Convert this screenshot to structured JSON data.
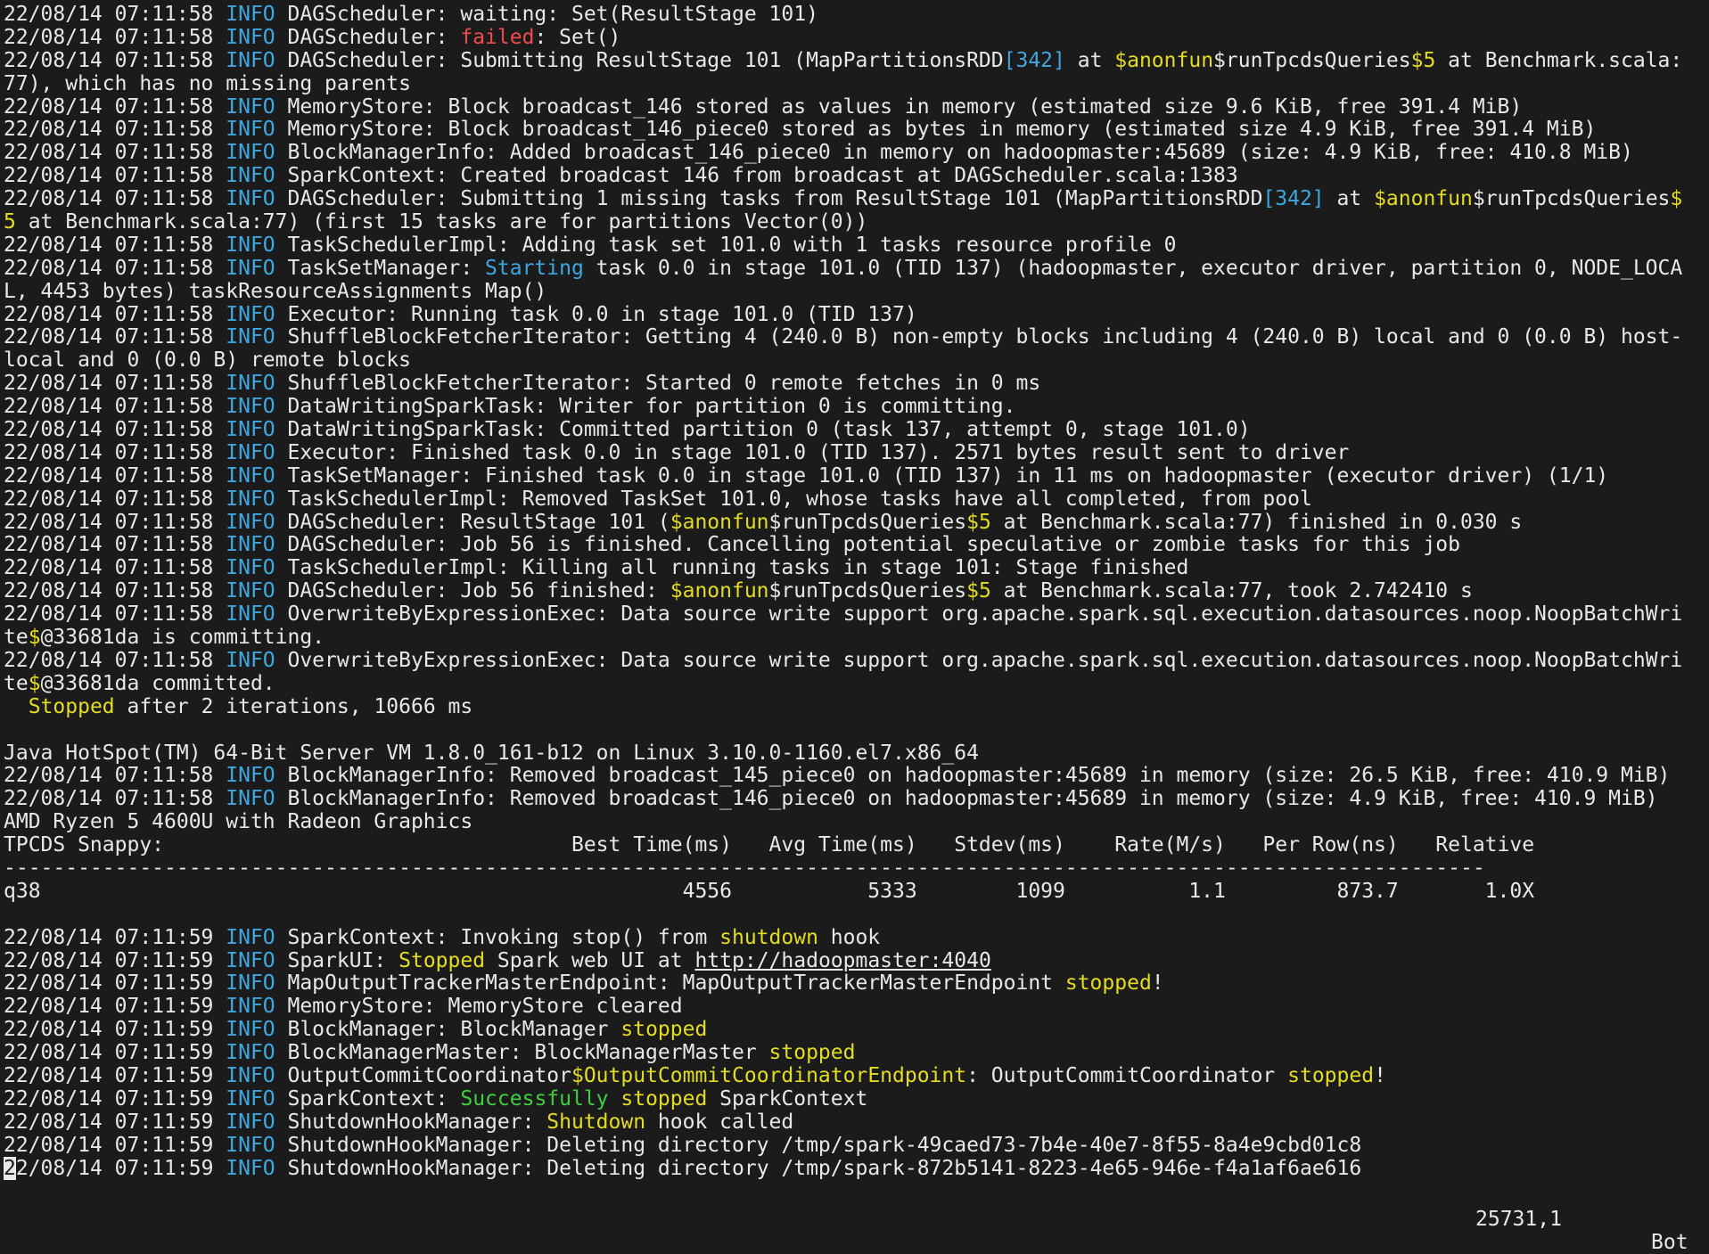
{
  "theme": {
    "background": "#1b1b1b",
    "foreground": "#e8e8e8",
    "info": "#3fa7e0",
    "failed": "#ef4c4c",
    "keyword": "#e4dc20",
    "success": "#3ed03e"
  },
  "terminal": {
    "lines": [
      [
        {
          "t": "22/08/14 07:11:58 "
        },
        {
          "t": "INFO",
          "c": "blue"
        },
        {
          "t": " DAGScheduler: waiting: Set(ResultStage 101)"
        }
      ],
      [
        {
          "t": "22/08/14 07:11:58 "
        },
        {
          "t": "INFO",
          "c": "blue"
        },
        {
          "t": " DAGScheduler: "
        },
        {
          "t": "failed",
          "c": "red"
        },
        {
          "t": ": Set()"
        }
      ],
      [
        {
          "t": "22/08/14 07:11:58 "
        },
        {
          "t": "INFO",
          "c": "blue"
        },
        {
          "t": " DAGScheduler: Submitting ResultStage 101 (MapPartitionsRDD"
        },
        {
          "t": "[342]",
          "c": "blue"
        },
        {
          "t": " at "
        },
        {
          "t": "$anonfun",
          "c": "yellow"
        },
        {
          "t": "$runTpcdsQueries"
        },
        {
          "t": "$5",
          "c": "yellow"
        },
        {
          "t": " at Benchmark.scala:"
        }
      ],
      [
        {
          "t": "77), which has no missing parents"
        }
      ],
      [
        {
          "t": "22/08/14 07:11:58 "
        },
        {
          "t": "INFO",
          "c": "blue"
        },
        {
          "t": " MemoryStore: Block broadcast_146 stored as values in memory (estimated size 9.6 KiB, free 391.4 MiB)"
        }
      ],
      [
        {
          "t": "22/08/14 07:11:58 "
        },
        {
          "t": "INFO",
          "c": "blue"
        },
        {
          "t": " MemoryStore: Block broadcast_146_piece0 stored as bytes in memory (estimated size 4.9 KiB, free 391.4 MiB)"
        }
      ],
      [
        {
          "t": "22/08/14 07:11:58 "
        },
        {
          "t": "INFO",
          "c": "blue"
        },
        {
          "t": " BlockManagerInfo: Added broadcast_146_piece0 in memory on hadoopmaster:45689 (size: 4.9 KiB, free: 410.8 MiB)"
        }
      ],
      [
        {
          "t": "22/08/14 07:11:58 "
        },
        {
          "t": "INFO",
          "c": "blue"
        },
        {
          "t": " SparkContext: Created broadcast 146 from broadcast at DAGScheduler.scala:1383"
        }
      ],
      [
        {
          "t": "22/08/14 07:11:58 "
        },
        {
          "t": "INFO",
          "c": "blue"
        },
        {
          "t": " DAGScheduler: Submitting 1 missing tasks from ResultStage 101 (MapPartitionsRDD"
        },
        {
          "t": "[342]",
          "c": "blue"
        },
        {
          "t": " at "
        },
        {
          "t": "$anonfun",
          "c": "yellow"
        },
        {
          "t": "$runTpcdsQueries"
        },
        {
          "t": "$",
          "c": "yellow"
        }
      ],
      [
        {
          "t": "5",
          "c": "yellow"
        },
        {
          "t": " at Benchmark.scala:77) (first 15 tasks are for partitions Vector(0))"
        }
      ],
      [
        {
          "t": "22/08/14 07:11:58 "
        },
        {
          "t": "INFO",
          "c": "blue"
        },
        {
          "t": " TaskSchedulerImpl: Adding task set 101.0 with 1 tasks resource profile 0"
        }
      ],
      [
        {
          "t": "22/08/14 07:11:58 "
        },
        {
          "t": "INFO",
          "c": "blue"
        },
        {
          "t": " TaskSetManager: "
        },
        {
          "t": "Starting",
          "c": "blue"
        },
        {
          "t": " task 0.0 in stage 101.0 (TID 137) (hadoopmaster, executor driver, partition 0, NODE_LOCA"
        }
      ],
      [
        {
          "t": "L, 4453 bytes) taskResourceAssignments Map()"
        }
      ],
      [
        {
          "t": "22/08/14 07:11:58 "
        },
        {
          "t": "INFO",
          "c": "blue"
        },
        {
          "t": " Executor: Running task 0.0 in stage 101.0 (TID 137)"
        }
      ],
      [
        {
          "t": "22/08/14 07:11:58 "
        },
        {
          "t": "INFO",
          "c": "blue"
        },
        {
          "t": " ShuffleBlockFetcherIterator: Getting 4 (240.0 B) non-empty blocks including 4 (240.0 B) local and 0 (0.0 B) host-"
        }
      ],
      [
        {
          "t": "local and 0 (0.0 B) remote blocks"
        }
      ],
      [
        {
          "t": "22/08/14 07:11:58 "
        },
        {
          "t": "INFO",
          "c": "blue"
        },
        {
          "t": " ShuffleBlockFetcherIterator: Started 0 remote fetches in 0 ms"
        }
      ],
      [
        {
          "t": "22/08/14 07:11:58 "
        },
        {
          "t": "INFO",
          "c": "blue"
        },
        {
          "t": " DataWritingSparkTask: Writer for partition 0 is committing."
        }
      ],
      [
        {
          "t": "22/08/14 07:11:58 "
        },
        {
          "t": "INFO",
          "c": "blue"
        },
        {
          "t": " DataWritingSparkTask: Committed partition 0 (task 137, attempt 0, stage 101.0)"
        }
      ],
      [
        {
          "t": "22/08/14 07:11:58 "
        },
        {
          "t": "INFO",
          "c": "blue"
        },
        {
          "t": " Executor: Finished task 0.0 in stage 101.0 (TID 137). 2571 bytes result sent to driver"
        }
      ],
      [
        {
          "t": "22/08/14 07:11:58 "
        },
        {
          "t": "INFO",
          "c": "blue"
        },
        {
          "t": " TaskSetManager: Finished task 0.0 in stage 101.0 (TID 137) in 11 ms on hadoopmaster (executor driver) (1/1)"
        }
      ],
      [
        {
          "t": "22/08/14 07:11:58 "
        },
        {
          "t": "INFO",
          "c": "blue"
        },
        {
          "t": " TaskSchedulerImpl: Removed TaskSet 101.0, whose tasks have all completed, from pool"
        }
      ],
      [
        {
          "t": "22/08/14 07:11:58 "
        },
        {
          "t": "INFO",
          "c": "blue"
        },
        {
          "t": " DAGScheduler: ResultStage 101 ("
        },
        {
          "t": "$anonfun",
          "c": "yellow"
        },
        {
          "t": "$runTpcdsQueries"
        },
        {
          "t": "$5",
          "c": "yellow"
        },
        {
          "t": " at Benchmark.scala:77) finished in 0.030 s"
        }
      ],
      [
        {
          "t": "22/08/14 07:11:58 "
        },
        {
          "t": "INFO",
          "c": "blue"
        },
        {
          "t": " DAGScheduler: Job 56 is finished. Cancelling potential speculative or zombie tasks for this job"
        }
      ],
      [
        {
          "t": "22/08/14 07:11:58 "
        },
        {
          "t": "INFO",
          "c": "blue"
        },
        {
          "t": " TaskSchedulerImpl: Killing all running tasks in stage 101: Stage finished"
        }
      ],
      [
        {
          "t": "22/08/14 07:11:58 "
        },
        {
          "t": "INFO",
          "c": "blue"
        },
        {
          "t": " DAGScheduler: Job 56 finished: "
        },
        {
          "t": "$anonfun",
          "c": "yellow"
        },
        {
          "t": "$runTpcdsQueries"
        },
        {
          "t": "$5",
          "c": "yellow"
        },
        {
          "t": " at Benchmark.scala:77, took 2.742410 s"
        }
      ],
      [
        {
          "t": "22/08/14 07:11:58 "
        },
        {
          "t": "INFO",
          "c": "blue"
        },
        {
          "t": " OverwriteByExpressionExec: Data source write support org.apache.spark.sql.execution.datasources.noop.NoopBatchWri"
        }
      ],
      [
        {
          "t": "te"
        },
        {
          "t": "$",
          "c": "yellow"
        },
        {
          "t": "@33681da is committing."
        }
      ],
      [
        {
          "t": "22/08/14 07:11:58 "
        },
        {
          "t": "INFO",
          "c": "blue"
        },
        {
          "t": " OverwriteByExpressionExec: Data source write support org.apache.spark.sql.execution.datasources.noop.NoopBatchWri"
        }
      ],
      [
        {
          "t": "te"
        },
        {
          "t": "$",
          "c": "yellow"
        },
        {
          "t": "@33681da committed."
        }
      ],
      [
        {
          "t": "  "
        },
        {
          "t": "Stopped",
          "c": "yellow"
        },
        {
          "t": " after 2 iterations, 10666 ms"
        }
      ],
      [
        {
          "t": ""
        }
      ],
      [
        {
          "t": "Java HotSpot(TM) 64-Bit Server VM 1.8.0_161-b12 on Linux 3.10.0-1160.el7.x86_64"
        }
      ],
      [
        {
          "t": "22/08/14 07:11:58 "
        },
        {
          "t": "INFO",
          "c": "blue"
        },
        {
          "t": " BlockManagerInfo: Removed broadcast_145_piece0 on hadoopmaster:45689 in memory (size: 26.5 KiB, free: 410.9 MiB)"
        }
      ],
      [
        {
          "t": "22/08/14 07:11:58 "
        },
        {
          "t": "INFO",
          "c": "blue"
        },
        {
          "t": " BlockManagerInfo: Removed broadcast_146_piece0 on hadoopmaster:45689 in memory (size: 4.9 KiB, free: 410.9 MiB)"
        }
      ],
      [
        {
          "t": "AMD Ryzen 5 4600U with Radeon Graphics"
        }
      ],
      [
        {
          "t": "TPCDS Snappy:                                 Best Time(ms)   Avg Time(ms)   Stdev(ms)    Rate(M/s)   Per Row(ns)   Relative"
        }
      ],
      [
        {
          "t": "------------------------------------------------------------------------------------------------------------------------"
        }
      ],
      [
        {
          "t": "q38                                                    4556           5333        1099          1.1         873.7       1.0X"
        }
      ],
      [
        {
          "t": ""
        }
      ],
      [
        {
          "t": "22/08/14 07:11:59 "
        },
        {
          "t": "INFO",
          "c": "blue"
        },
        {
          "t": " SparkContext: Invoking stop() from "
        },
        {
          "t": "shutdown",
          "c": "yellow"
        },
        {
          "t": " hook"
        }
      ],
      [
        {
          "t": "22/08/14 07:11:59 "
        },
        {
          "t": "INFO",
          "c": "blue"
        },
        {
          "t": " SparkUI: "
        },
        {
          "t": "Stopped",
          "c": "yellow"
        },
        {
          "t": " Spark web UI at "
        },
        {
          "t": "http://hadoopmaster:4040",
          "u": true
        }
      ],
      [
        {
          "t": "22/08/14 07:11:59 "
        },
        {
          "t": "INFO",
          "c": "blue"
        },
        {
          "t": " MapOutputTrackerMasterEndpoint: MapOutputTrackerMasterEndpoint "
        },
        {
          "t": "stopped",
          "c": "yellow"
        },
        {
          "t": "!"
        }
      ],
      [
        {
          "t": "22/08/14 07:11:59 "
        },
        {
          "t": "INFO",
          "c": "blue"
        },
        {
          "t": " MemoryStore: MemoryStore cleared"
        }
      ],
      [
        {
          "t": "22/08/14 07:11:59 "
        },
        {
          "t": "INFO",
          "c": "blue"
        },
        {
          "t": " BlockManager: BlockManager "
        },
        {
          "t": "stopped",
          "c": "yellow"
        }
      ],
      [
        {
          "t": "22/08/14 07:11:59 "
        },
        {
          "t": "INFO",
          "c": "blue"
        },
        {
          "t": " BlockManagerMaster: BlockManagerMaster "
        },
        {
          "t": "stopped",
          "c": "yellow"
        }
      ],
      [
        {
          "t": "22/08/14 07:11:59 "
        },
        {
          "t": "INFO",
          "c": "blue"
        },
        {
          "t": " OutputCommitCoordinator"
        },
        {
          "t": "$OutputCommitCoordinatorEndpoint",
          "c": "yellow"
        },
        {
          "t": ": OutputCommitCoordinator "
        },
        {
          "t": "stopped",
          "c": "yellow"
        },
        {
          "t": "!"
        }
      ],
      [
        {
          "t": "22/08/14 07:11:59 "
        },
        {
          "t": "INFO",
          "c": "blue"
        },
        {
          "t": " SparkContext: "
        },
        {
          "t": "Successfully",
          "c": "green"
        },
        {
          "t": " "
        },
        {
          "t": "stopped",
          "c": "yellow"
        },
        {
          "t": " SparkContext"
        }
      ],
      [
        {
          "t": "22/08/14 07:11:59 "
        },
        {
          "t": "INFO",
          "c": "blue"
        },
        {
          "t": " ShutdownHookManager: "
        },
        {
          "t": "Shutdown",
          "c": "yellow"
        },
        {
          "t": " hook called"
        }
      ],
      [
        {
          "t": "22/08/14 07:11:59 "
        },
        {
          "t": "INFO",
          "c": "blue"
        },
        {
          "t": " ShutdownHookManager: Deleting directory /tmp/spark-49caed73-7b4e-40e7-8f55-8a4e9cbd01c8"
        }
      ],
      [
        {
          "t": "2",
          "cursor": true
        },
        {
          "t": "2/08/14 07:11:59 "
        },
        {
          "t": "INFO",
          "c": "blue"
        },
        {
          "t": " ShutdownHookManager: Deleting directory /tmp/spark-872b5141-8223-4e65-946e-f4a1af6ae616"
        }
      ]
    ]
  },
  "statusbar": {
    "position": "25731,1",
    "scroll": "Bot"
  }
}
